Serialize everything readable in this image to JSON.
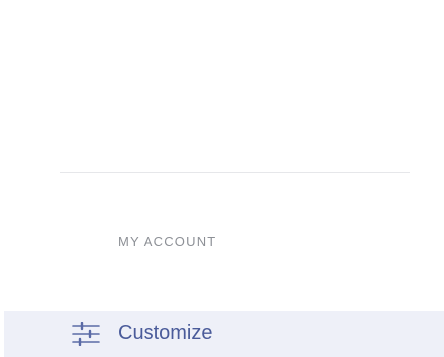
{
  "menu": {
    "section_header": "MY ACCOUNT",
    "customize": {
      "label": "Customize",
      "icon": "sliders-icon",
      "accent_color": "#4a5b9a",
      "highlight_bg": "#eef0f8"
    }
  }
}
